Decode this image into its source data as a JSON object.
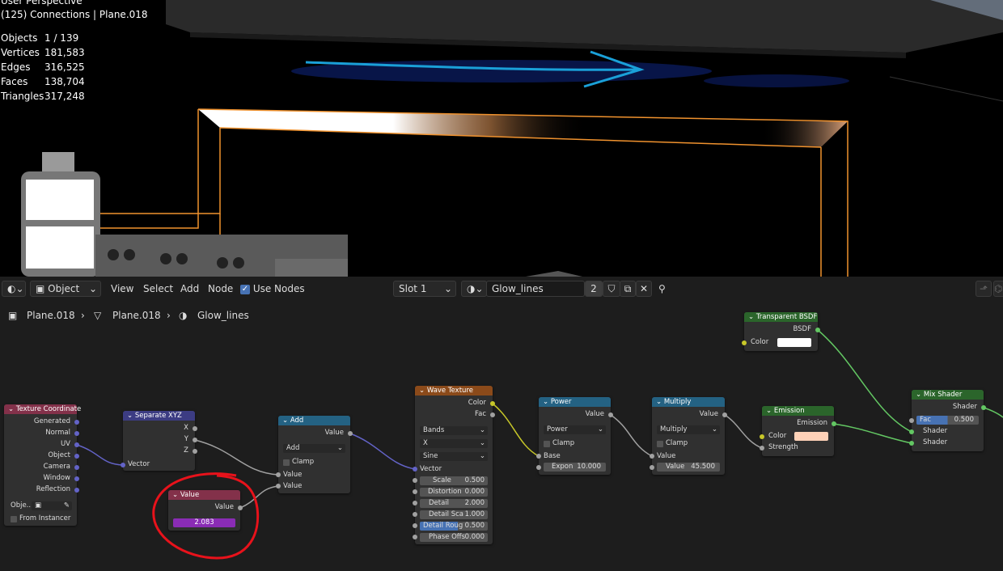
{
  "viewport": {
    "view_name": "User Perspective",
    "collection": "(125) Connections | Plane.018",
    "stats": [
      {
        "label": "Objects",
        "value": "1 / 139"
      },
      {
        "label": "Vertices",
        "value": "181,583"
      },
      {
        "label": "Edges",
        "value": "316,525"
      },
      {
        "label": "Faces",
        "value": "138,704"
      },
      {
        "label": "Triangles",
        "value": "317,248"
      }
    ]
  },
  "header": {
    "mode": "Object",
    "menus": [
      "View",
      "Select",
      "Add",
      "Node"
    ],
    "use_nodes_label": "Use Nodes",
    "slot": "Slot 1",
    "material": "Glow_lines",
    "users": "2"
  },
  "breadcrumb": [
    "Plane.018",
    "Plane.018",
    "Glow_lines"
  ],
  "nodes": {
    "texcoord": {
      "title": "Texture Coordinate",
      "outputs": [
        "Generated",
        "Normal",
        "UV",
        "Object",
        "Camera",
        "Window",
        "Reflection"
      ],
      "object_label": "Obje...",
      "from_instancer": "From Instancer"
    },
    "separate": {
      "title": "Separate XYZ",
      "outputs": [
        "X",
        "Y",
        "Z"
      ],
      "input": "Vector"
    },
    "value": {
      "title": "Value",
      "output": "Value",
      "value": "2.083"
    },
    "add": {
      "title": "Add",
      "output": "Value",
      "op": "Add",
      "clamp": "Clamp",
      "in1": "Value",
      "in2": "Value"
    },
    "wave": {
      "title": "Wave Texture",
      "out_color": "Color",
      "out_fac": "Fac",
      "type": "Bands",
      "axis": "X",
      "profile": "Sine",
      "vector": "Vector",
      "fields": [
        {
          "label": "Scale",
          "value": "0.500"
        },
        {
          "label": "Distortion",
          "value": "0.000"
        },
        {
          "label": "Detail",
          "value": "2.000"
        },
        {
          "label": "Detail Sca",
          "value": "1.000"
        },
        {
          "label": "Detail Roug",
          "value": "0.500"
        },
        {
          "label": "Phase Offs",
          "value": "0.000"
        }
      ]
    },
    "power": {
      "title": "Power",
      "output": "Value",
      "op": "Power",
      "clamp": "Clamp",
      "base": "Base",
      "expon_label": "Expon",
      "expon": "10.000"
    },
    "multiply": {
      "title": "Multiply",
      "output": "Value",
      "op": "Multiply",
      "clamp": "Clamp",
      "in1": "Value",
      "in2_label": "Value",
      "in2": "45.500"
    },
    "emission": {
      "title": "Emission",
      "output": "Emission",
      "color": "Color",
      "strength": "Strength",
      "color_hex": "#ffd2b8"
    },
    "transparent": {
      "title": "Transparent BSDF",
      "output": "BSDF",
      "color": "Color",
      "color_hex": "#ffffff"
    },
    "mix": {
      "title": "Mix Shader",
      "output": "Shader",
      "fac_label": "Fac",
      "fac": "0.500",
      "shader1": "Shader",
      "shader2": "Shader"
    }
  },
  "colors": {
    "input_header": "#83314a",
    "vector_header": "#3c3c83",
    "converter_header": "#246283",
    "texture_header": "#e66e1e",
    "shader_header": "#2b652b",
    "annotation": "#e8121b",
    "accent": "#4772b3"
  }
}
